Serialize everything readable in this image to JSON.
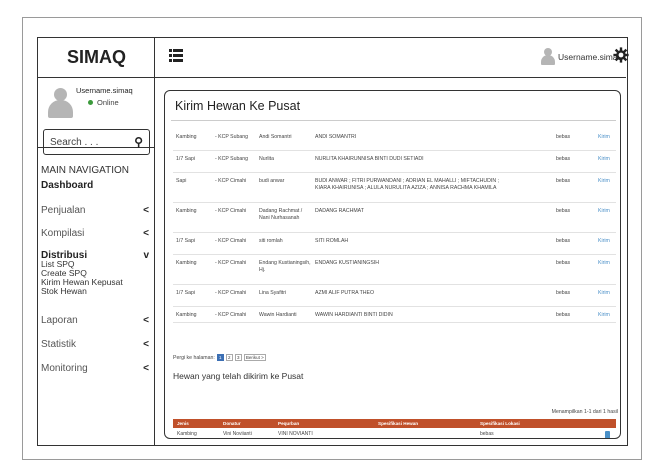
{
  "app": {
    "title": "SIMAQ"
  },
  "user": {
    "name": "Username.simaq",
    "status": "Online",
    "top_name": "Username.simaq"
  },
  "search": {
    "placeholder": "Search . . ."
  },
  "nav": {
    "header": "MAIN NAVIGATION",
    "dashboard": "Dashboard",
    "items": [
      {
        "label": "Penjualan",
        "chevron": "<"
      },
      {
        "label": "Kompilasi",
        "chevron": "<"
      },
      {
        "label": "Distribusi",
        "chevron": "v"
      },
      {
        "label": "Laporan",
        "chevron": "<"
      },
      {
        "label": "Statistik",
        "chevron": "<"
      },
      {
        "label": "Monitoring",
        "chevron": "<"
      }
    ],
    "distribusi_sub": [
      "List SPQ",
      "Create SPQ",
      "Kirim Hewan Kepusat",
      "Stok Hewan"
    ]
  },
  "page": {
    "title": "Kirim Hewan Ke Pusat"
  },
  "table": {
    "rows": [
      {
        "jenis": "Kambing",
        "kcp": "- KCP Subang",
        "nama": "Andi Somantri",
        "pequrban": "ANDI SOMANTRI",
        "status": "bebas",
        "action": "Kirim"
      },
      {
        "jenis": "1/7 Sapi",
        "kcp": "- KCP Subang",
        "nama": "Nurlita",
        "pequrban": "NURLITA KHAIRUNNISA BINTI DUDI SETIADI",
        "status": "bebas",
        "action": "Kirim"
      },
      {
        "jenis": "Sapi",
        "kcp": "- KCP Cimahi",
        "nama": "budi anwar",
        "pequrban": "BUDI ANWAR ; FITRI PURWANDANI ; ADRIAN EL MAHALLI ; MIFTACHUDIN ; KIARA KHAIRUNISA ; ALULA NURULITA AZIZA ; ANNISA RACHMA KHAMILA",
        "status": "bebas",
        "action": "Kirim"
      },
      {
        "jenis": "Kambing",
        "kcp": "- KCP Cimahi",
        "nama": "Dadang Rachmat / Nani Nurhasanah",
        "pequrban": "DADANG RACHMAT",
        "status": "bebas",
        "action": "Kirim"
      },
      {
        "jenis": "1/7 Sapi",
        "kcp": "- KCP Cimahi",
        "nama": "siti romlah",
        "pequrban": "SITI ROMLAH",
        "status": "bebas",
        "action": "Kirim"
      },
      {
        "jenis": "Kambing",
        "kcp": "- KCP Cimahi",
        "nama": "Endang Kustianingsih, Hj.",
        "pequrban": "ENDANG KUSTIANINGSIH",
        "status": "bebas",
        "action": "Kirim"
      },
      {
        "jenis": "1/7 Sapi",
        "kcp": "- KCP Cimahi",
        "nama": "Lina Syafitri",
        "pequrban": "AZMI ALIF PUTRA THEO",
        "status": "bebas",
        "action": "Kirim"
      },
      {
        "jenis": "Kambing",
        "kcp": "- KCP Cimahi",
        "nama": "Wawin Hardianti",
        "pequrban": "WAWIN HARDIANTI BINTI DIDIN",
        "status": "bebas",
        "action": "Kirim"
      }
    ],
    "pager_label": "Pergi ke halaman:",
    "pages": [
      "1",
      "2",
      "3"
    ],
    "next": "Berikut >"
  },
  "sent": {
    "title": "Hewan yang telah dikirim ke Pusat",
    "showing": "Menampilkan 1-1 dari 1 hasil",
    "headers": [
      "Jenis",
      "Donatur",
      "Pequrban",
      "Spesifikasi Hewan",
      "Spesifikasi Lokasi",
      ""
    ],
    "rows": [
      {
        "jenis": "Kambing",
        "donatur": "Vini Noviianti",
        "pequrban": "VINI NOVIANTI",
        "spes_hewan": "",
        "spes_lokasi": "bebas"
      }
    ]
  }
}
